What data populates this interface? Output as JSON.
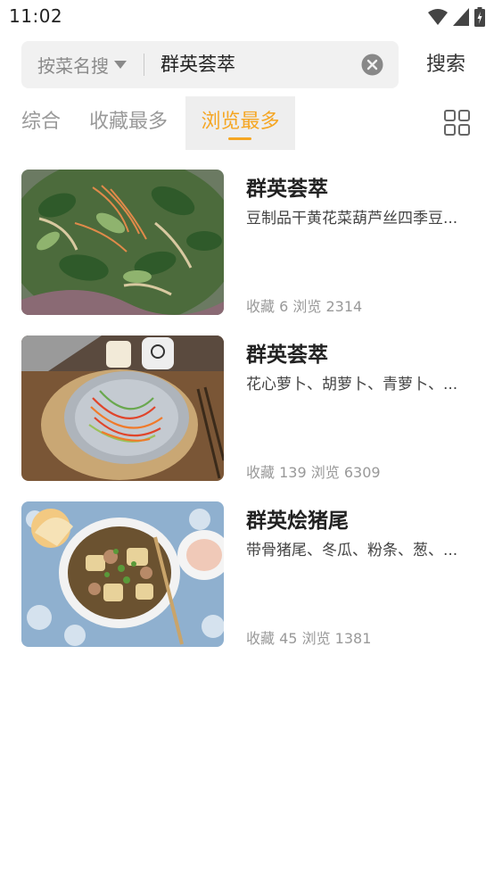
{
  "status_bar": {
    "time": "11:02",
    "icons": [
      "wifi-icon",
      "signal-icon",
      "battery-icon"
    ]
  },
  "search": {
    "type_label": "按菜名搜",
    "query": "群英荟萃",
    "submit_label": "搜索"
  },
  "tabs": [
    {
      "label": "综合",
      "active": false
    },
    {
      "label": "收藏最多",
      "active": false
    },
    {
      "label": "浏览最多",
      "active": true
    }
  ],
  "colors": {
    "accent": "#f5a623",
    "muted_text": "#999999",
    "search_bg": "#f1f1f1"
  },
  "recipes": [
    {
      "title": "群英荟萃",
      "ingredients": "豆制品干黄花菜葫芦丝四季豆...",
      "favorites_label": "收藏",
      "favorites": "6",
      "views_label": "浏览",
      "views": "2314"
    },
    {
      "title": "群英荟萃",
      "ingredients": "花心萝卜、胡萝卜、青萝卜、...",
      "favorites_label": "收藏",
      "favorites": "139",
      "views_label": "浏览",
      "views": "6309"
    },
    {
      "title": "群英烩猪尾",
      "ingredients": "带骨猪尾、冬瓜、粉条、葱、...",
      "favorites_label": "收藏",
      "favorites": "45",
      "views_label": "浏览",
      "views": "1381"
    }
  ]
}
